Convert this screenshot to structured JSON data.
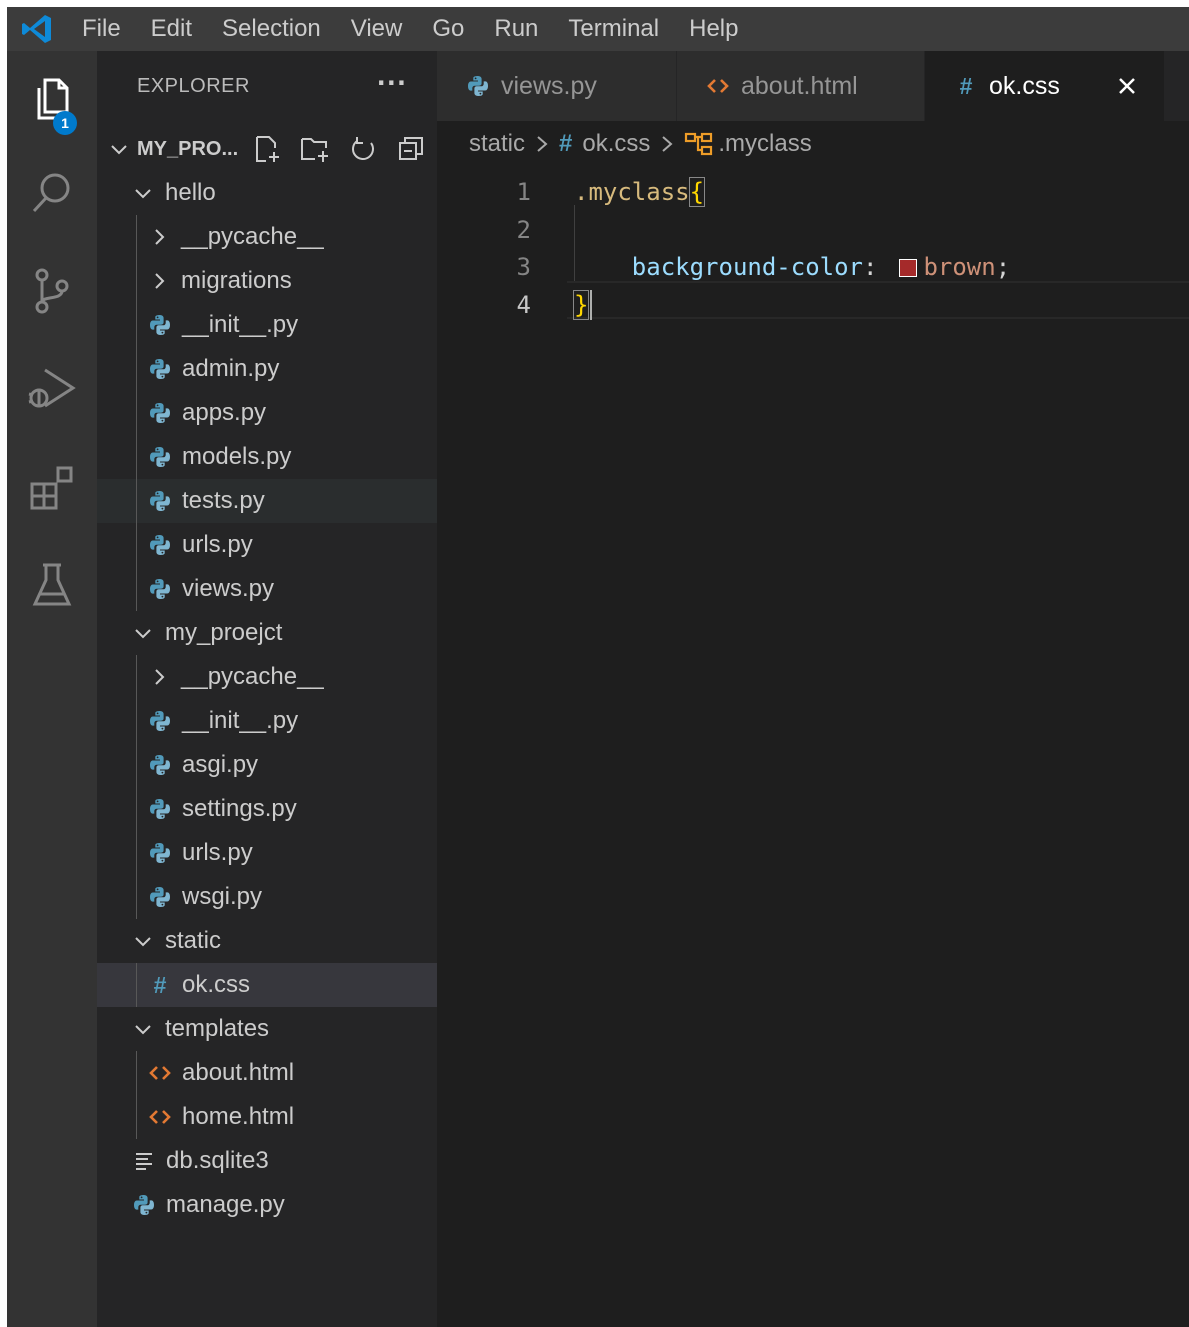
{
  "menu": [
    "File",
    "Edit",
    "Selection",
    "View",
    "Go",
    "Run",
    "Terminal",
    "Help"
  ],
  "activity": {
    "explorer_badge": "1",
    "items": [
      "explorer-icon",
      "search-icon",
      "source-control-icon",
      "run-debug-icon",
      "extensions-icon",
      "testing-icon"
    ]
  },
  "sidebar": {
    "title": "EXPLORER",
    "more": "···",
    "project": "MY_PRO...",
    "tree": [
      {
        "label": "hello",
        "type": "folder-open",
        "level": 1
      },
      {
        "label": "__pycache__",
        "type": "folder-closed",
        "level": 2
      },
      {
        "label": "migrations",
        "type": "folder-closed",
        "level": 2
      },
      {
        "label": "__init__.py",
        "type": "py",
        "level": 2
      },
      {
        "label": "admin.py",
        "type": "py",
        "level": 2
      },
      {
        "label": "apps.py",
        "type": "py",
        "level": 2
      },
      {
        "label": "models.py",
        "type": "py",
        "level": 2
      },
      {
        "label": "tests.py",
        "type": "py",
        "level": 2,
        "state": "hover"
      },
      {
        "label": "urls.py",
        "type": "py",
        "level": 2
      },
      {
        "label": "views.py",
        "type": "py",
        "level": 2
      },
      {
        "label": "my_proejct",
        "type": "folder-open",
        "level": 1
      },
      {
        "label": "__pycache__",
        "type": "folder-closed",
        "level": 2
      },
      {
        "label": "__init__.py",
        "type": "py",
        "level": 2
      },
      {
        "label": "asgi.py",
        "type": "py",
        "level": 2
      },
      {
        "label": "settings.py",
        "type": "py",
        "level": 2
      },
      {
        "label": "urls.py",
        "type": "py",
        "level": 2
      },
      {
        "label": "wsgi.py",
        "type": "py",
        "level": 2
      },
      {
        "label": "static",
        "type": "folder-open",
        "level": 1
      },
      {
        "label": "ok.css",
        "type": "css",
        "level": 2,
        "state": "selected"
      },
      {
        "label": "templates",
        "type": "folder-open",
        "level": 1
      },
      {
        "label": "about.html",
        "type": "html",
        "level": 2
      },
      {
        "label": "home.html",
        "type": "html",
        "level": 2
      },
      {
        "label": "db.sqlite3",
        "type": "db",
        "level": 1
      },
      {
        "label": "manage.py",
        "type": "py",
        "level": 1
      }
    ]
  },
  "tabs": [
    {
      "label": "views.py",
      "type": "py",
      "active": false
    },
    {
      "label": "about.html",
      "type": "html",
      "active": false
    },
    {
      "label": "ok.css",
      "type": "css",
      "active": true,
      "close": "×"
    }
  ],
  "breadcrumb": {
    "folder": "static",
    "hash": "#",
    "file": "ok.css",
    "symbol": ".myclass"
  },
  "editor": {
    "active_line": 4,
    "line_numbers": [
      "1",
      "2",
      "3",
      "4"
    ],
    "line1": {
      "selector": ".myclass",
      "brace": "{"
    },
    "line3": {
      "indent": "    ",
      "property": "background-color",
      "colon": ":",
      "value": "brown",
      "semicolon": ";"
    },
    "line4": {
      "brace": "}"
    }
  },
  "colors": {
    "python_icon": "#519aba",
    "css_icon": "#519aba",
    "html_icon": "#e37933",
    "swatch": "#a52a2a",
    "accent": "#007acc"
  }
}
